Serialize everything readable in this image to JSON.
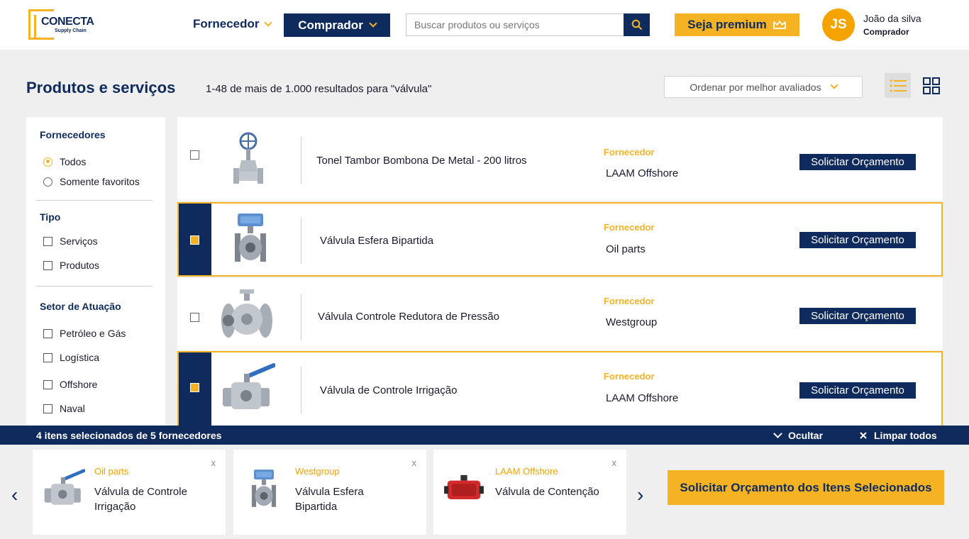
{
  "brand": {
    "name": "CONECTA",
    "tagline": "Supply Chain"
  },
  "colors": {
    "navy": "#0f2a5c",
    "gold": "#f5b324",
    "orange": "#f5a300"
  },
  "nav": {
    "fornecedor": "Fornecedor",
    "comprador": "Comprador"
  },
  "search": {
    "placeholder": "Buscar produtos ou serviços"
  },
  "premium": {
    "label": "Seja premium"
  },
  "user": {
    "initials": "JS",
    "name": "João da silva",
    "role": "Comprador"
  },
  "page": {
    "title": "Produtos e serviços",
    "results": "1-48 de mais de 1.000 resultados para \"válvula\"",
    "sort": "Ordenar por melhor avaliados"
  },
  "filters": {
    "fornecedores": {
      "title": "Fornecedores",
      "options": [
        "Todos",
        "Somente favoritos"
      ],
      "selected": "Todos"
    },
    "tipo": {
      "title": "Tipo",
      "options": [
        "Serviços",
        "Produtos"
      ]
    },
    "setor": {
      "title": "Setor de Atuação",
      "options": [
        "Petróleo e Gás",
        "Logística",
        "Offshore",
        "Naval"
      ]
    }
  },
  "list": {
    "supplier_label": "Fornecedor",
    "quote_label": "Solicitar Orçamento",
    "items": [
      {
        "name": "Tonel Tambor Bombona De Metal - 200 litros",
        "supplier": "LAAM Offshore",
        "selected": false,
        "thumb": "gate-valve"
      },
      {
        "name": "Válvula Esfera Bipartida",
        "supplier": "Oil parts",
        "selected": true,
        "thumb": "actuated-ball-valve"
      },
      {
        "name": "Válvula Controle Redutora de Pressão",
        "supplier": "Westgroup",
        "selected": false,
        "thumb": "flanged-ball-valve"
      },
      {
        "name": "Válvula de Controle Irrigação",
        "supplier": "LAAM Offshore",
        "selected": true,
        "thumb": "lever-ball-valve"
      }
    ]
  },
  "selection": {
    "count": "4 itens selecionados de 5 fornecedores",
    "hide": "Ocultar",
    "clear": "Limpar todos",
    "close": "x",
    "cards": [
      {
        "supplier": "Oil parts",
        "name": "Válvula de Controle Irrigação",
        "thumb": "lever-ball-valve"
      },
      {
        "supplier": "Westgroup",
        "name": "Válvula Esfera Bipartida",
        "thumb": "actuated-ball-valve"
      },
      {
        "supplier": "LAAM Offshore",
        "name": "Válvula de Contenção",
        "thumb": "actuator"
      }
    ],
    "cta": "Solicitar Orçamento dos Itens Selecionados"
  }
}
